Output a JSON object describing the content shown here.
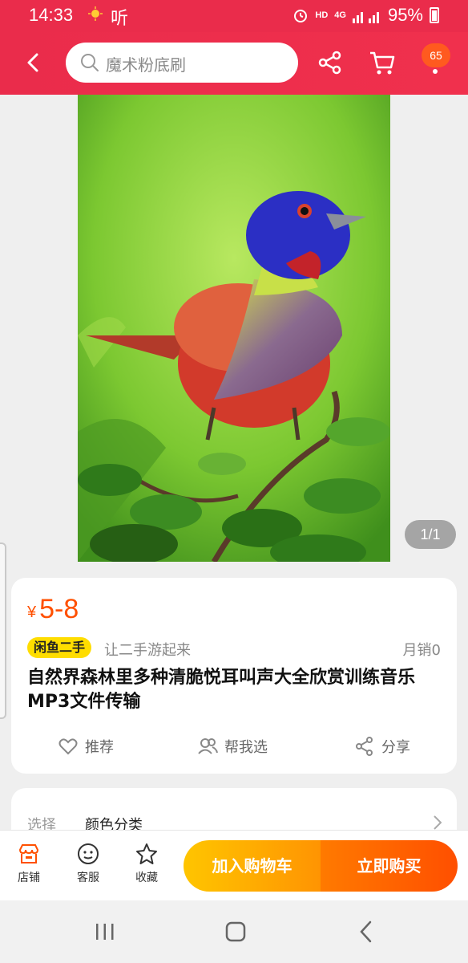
{
  "status_bar": {
    "time": "14:33",
    "extra": "听",
    "network_hd": "HD",
    "network_4g": "4G",
    "battery": "95%"
  },
  "header": {
    "search_placeholder": "魔术粉底刷",
    "cart_badge": "65"
  },
  "gallery": {
    "counter": "1/1"
  },
  "product": {
    "currency": "¥",
    "price": "5-8",
    "tag": "闲鱼二手",
    "slogan": "让二手游起来",
    "sales": "月销0",
    "title": "自然界森林里多种清脆悦耳叫声大全欣赏训练音乐MP3文件传输",
    "actions": {
      "recommend": "推荐",
      "help_choose": "帮我选",
      "share": "分享"
    }
  },
  "options": {
    "label": "选择",
    "value": "颜色分类"
  },
  "bottom_bar": {
    "shop": "店铺",
    "service": "客服",
    "favorite": "收藏",
    "add_cart": "加入购物车",
    "buy_now": "立即购买"
  },
  "colors": {
    "header_red": "#ea2c4b",
    "price_orange": "#ff5000",
    "cart_yellow": "#ffc500",
    "buy_orange": "#ff4f00",
    "tag_yellow": "#ffdd00"
  }
}
